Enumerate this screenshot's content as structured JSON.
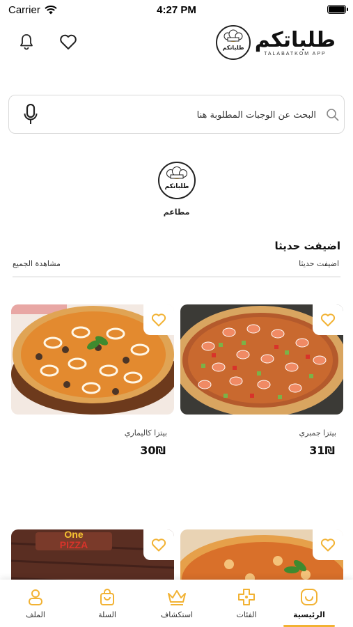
{
  "status": {
    "carrier": "Carrier",
    "time": "4:27 PM"
  },
  "header": {
    "logo_text": "طلباتكم",
    "logo_sub": "TALABATKOM APP"
  },
  "search": {
    "placeholder": "البحث عن الوجبات المطلوبة هنا",
    "value": ""
  },
  "category": {
    "label": "مطاعم"
  },
  "section": {
    "title": "اضيفت حديثا",
    "subtitle": "اضيفت حديثا",
    "see_all": "مشاهدة الجميع"
  },
  "products": [
    {
      "name": "بيتزا جمبري",
      "price": "31₪"
    },
    {
      "name": "بيتزا كاليماري",
      "price": "30₪"
    },
    {
      "name": "",
      "price": ""
    },
    {
      "name": "",
      "price": ""
    }
  ],
  "nav": [
    {
      "label": "الرئيسية",
      "icon": "home-icon",
      "active": true
    },
    {
      "label": "الفئات",
      "icon": "categories-icon"
    },
    {
      "label": "استكشاف",
      "icon": "explore-icon"
    },
    {
      "label": "السلة",
      "icon": "cart-icon"
    },
    {
      "label": "الملف",
      "icon": "profile-icon"
    }
  ],
  "colors": {
    "accent": "#f2b233",
    "text": "#222222",
    "border": "#d9d9d9"
  },
  "logo_badge_text": "طلباتكم"
}
